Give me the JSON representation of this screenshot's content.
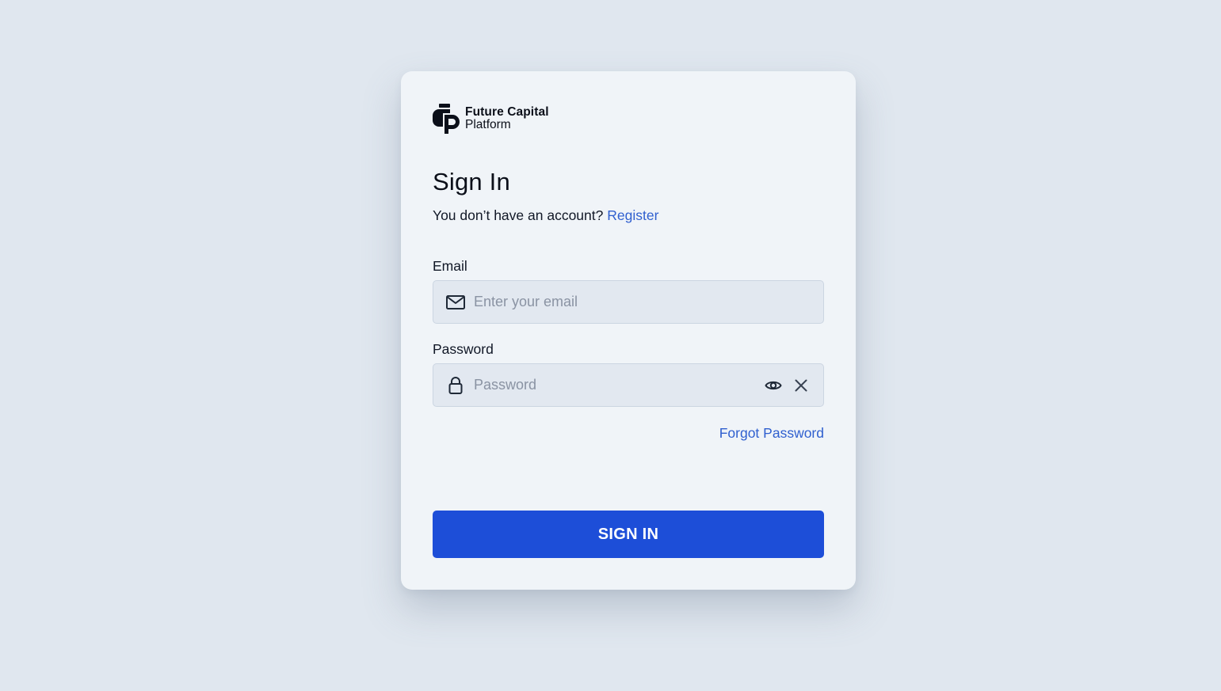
{
  "brand": {
    "name_line1": "Future Capital",
    "name_line2": "Platform",
    "logo_icon": "future-capital-logo"
  },
  "heading": "Sign In",
  "register_prompt": {
    "text": "You don’t have an account?",
    "link_label": "Register"
  },
  "email": {
    "label": "Email",
    "value": "",
    "placeholder": "Enter your email",
    "icon": "mail-icon"
  },
  "password": {
    "label": "Password",
    "value": "",
    "placeholder": "Password",
    "icon": "lock-icon",
    "show_icon": "eye-icon",
    "clear_icon": "close-icon"
  },
  "forgot_password_label": "Forgot Password",
  "submit_label": "SIGN IN",
  "colors": {
    "background": "#e0e7ef",
    "card": "#f0f4f8",
    "input_background": "#e2e8f0",
    "link": "#2f5fcf",
    "primary_button": "#1d4ed8"
  }
}
